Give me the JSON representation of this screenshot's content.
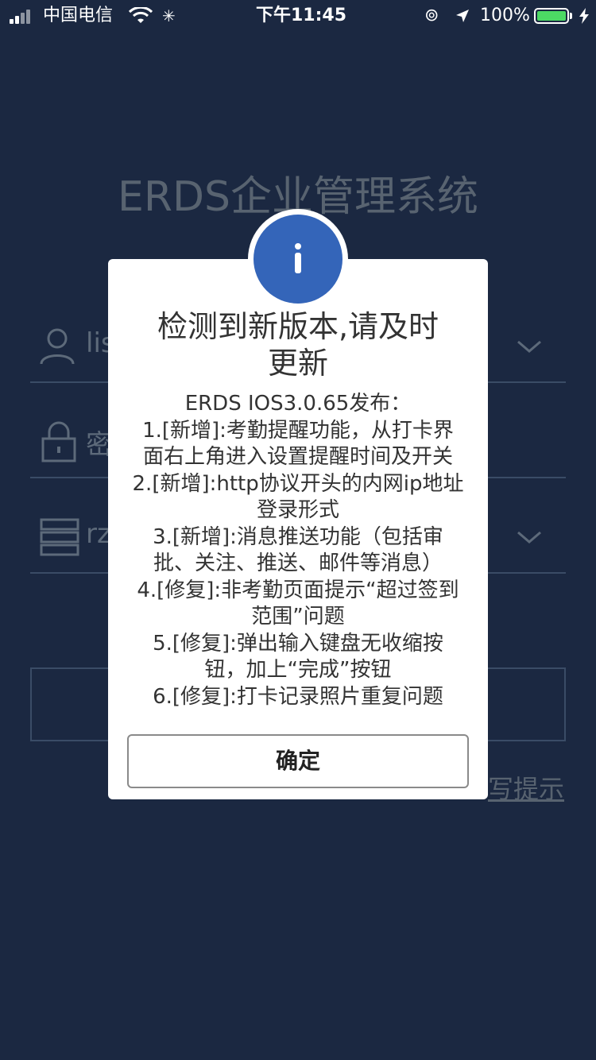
{
  "status_bar": {
    "carrier": "中国电信",
    "time": "下午11:45",
    "battery": "100%"
  },
  "background": {
    "app_title": "ERDS企业管理系统",
    "username_value": "lis",
    "password_placeholder": "密",
    "server_value": "rz",
    "tip_link": "写提示"
  },
  "dialog": {
    "icon": "info-icon",
    "title_lines": [
      "检测到新版本,请及时",
      "更新"
    ],
    "body_lines": [
      "ERDS IOS3.0.65发布：",
      "1.[新增]:考勤提醒功能，从打卡界",
      "面右上角进入设置提醒时间及开关",
      "2.[新增]:http协议开头的内网ip地址",
      "登录形式",
      "3.[新增]:消息推送功能（包括审",
      "批、关注、推送、邮件等消息）",
      "4.[修复]:非考勤页面提示“超过签到",
      "范围”问题",
      "5.[修复]:弹出输入键盘无收缩按",
      "钮，加上“完成”按钮",
      "6.[修复]:打卡记录照片重复问题"
    ],
    "confirm_label": "确定"
  }
}
